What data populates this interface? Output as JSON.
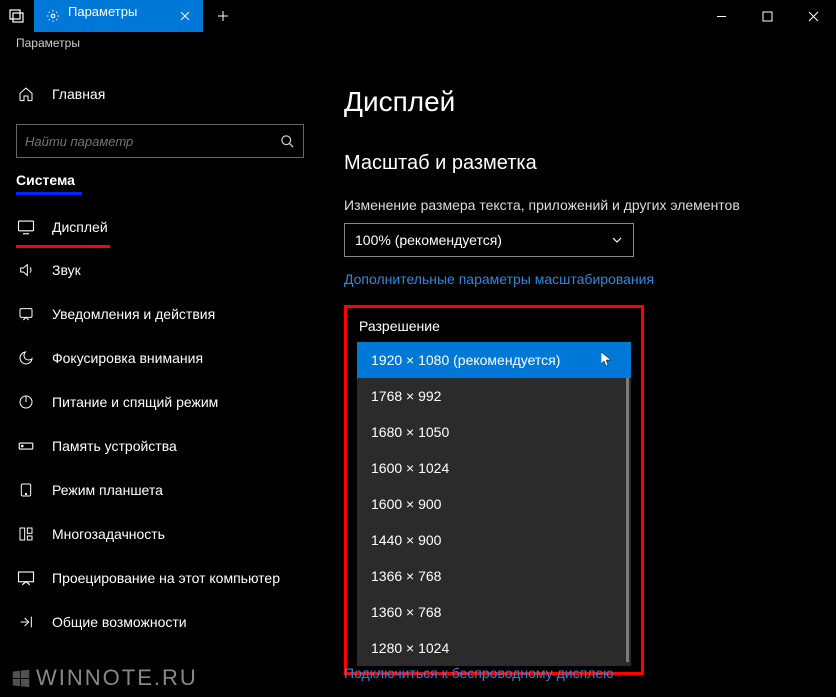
{
  "titlebar": {
    "tab_label": "Параметры"
  },
  "breadcrumb": "Параметры",
  "sidebar": {
    "home": "Главная",
    "search_placeholder": "Найти параметр",
    "section": "Система",
    "items": [
      "Дисплей",
      "Звук",
      "Уведомления и действия",
      "Фокусировка внимания",
      "Питание и спящий режим",
      "Память устройства",
      "Режим планшета",
      "Многозадачность",
      "Проецирование на этот компьютер",
      "Общие возможности"
    ]
  },
  "content": {
    "title": "Дисплей",
    "section": "Масштаб и разметка",
    "scale_label": "Изменение размера текста, приложений и других элементов",
    "scale_value": "100% (рекомендуется)",
    "scale_link": "Дополнительные параметры масштабирования",
    "resolution_label": "Разрешение",
    "resolutions": [
      "1920 × 1080 (рекомендуется)",
      "1768 × 992",
      "1680 × 1050",
      "1600 × 1024",
      "1600 × 900",
      "1440 × 900",
      "1366 × 768",
      "1360 × 768",
      "1280 × 1024"
    ],
    "connect_link": "Подключиться к беспроводному дисплею"
  },
  "watermark": "WINNOTE.RU"
}
